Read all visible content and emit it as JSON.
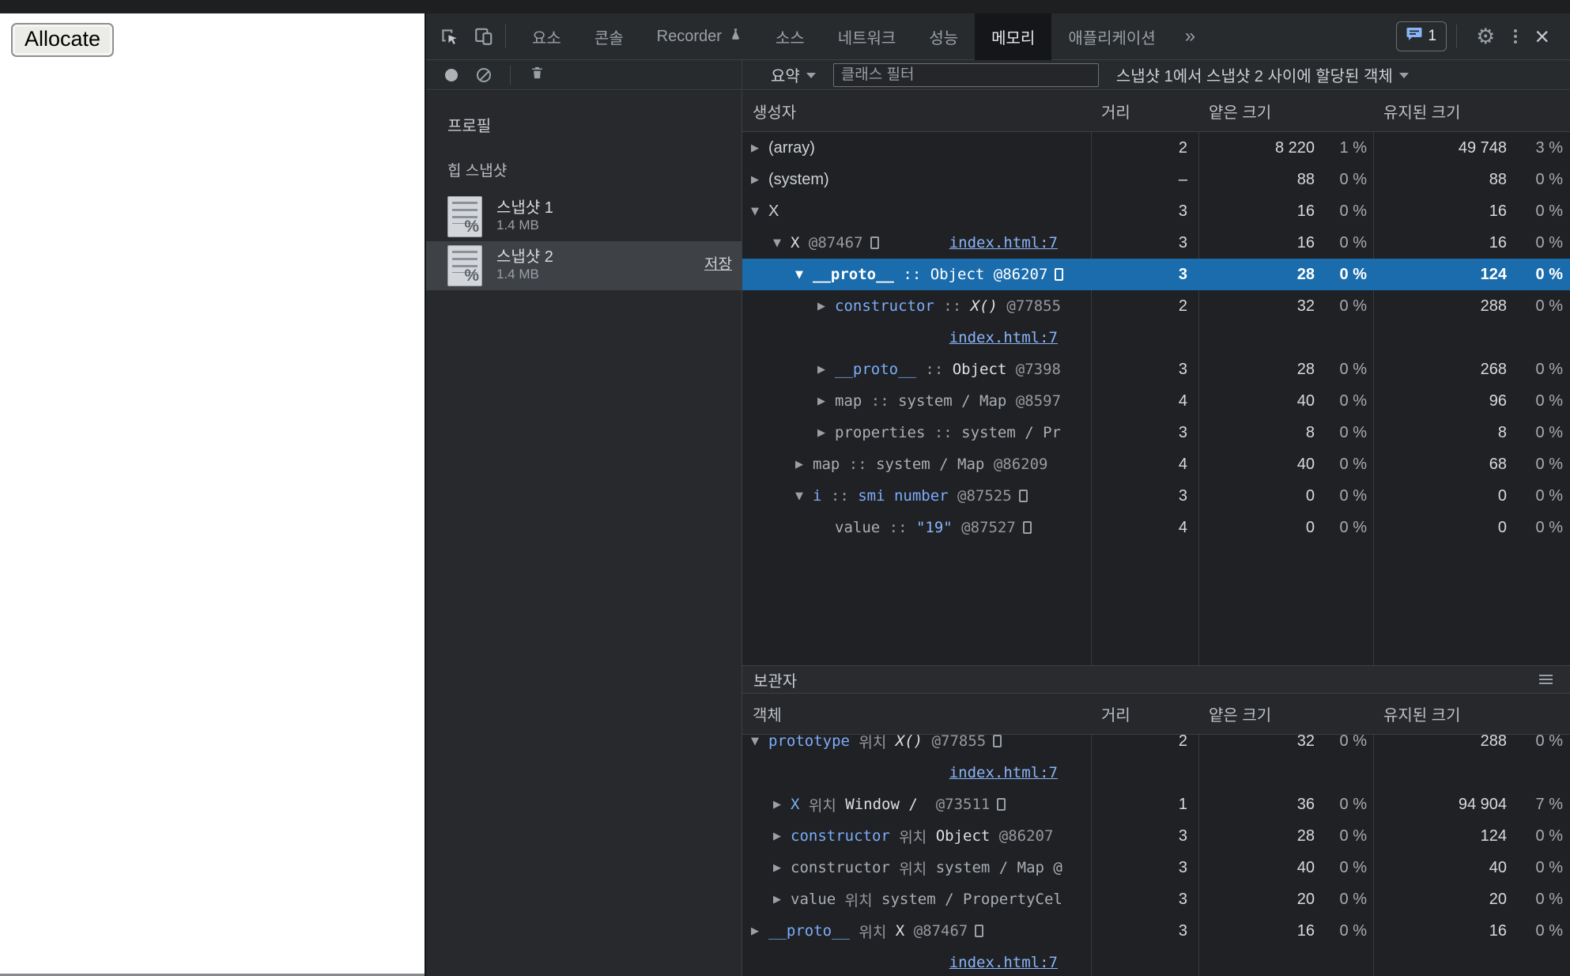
{
  "page": {
    "allocate_button": "Allocate"
  },
  "devtools": {
    "colors": {
      "selection_blue": "#1a6cac",
      "link_blue": "#8ab4f8",
      "property_blue": "#7cacf8",
      "panel_bg": "#1f2124",
      "chrome_bg": "#282b2e"
    },
    "tabs": {
      "items": [
        "요소",
        "콘솔",
        "Recorder",
        "소스",
        "네트워크",
        "성능",
        "메모리",
        "애플리케이션"
      ],
      "selected": "메모리",
      "overflow": "»",
      "issues_badge": "1"
    },
    "toolbar": {
      "summary_label": "요약",
      "filter_placeholder": "클래스 필터",
      "scope_label": "스냅샷 1에서 스냅샷 2 사이에 할당된 객체"
    },
    "sidebar": {
      "profiles_label": "프로필",
      "heap_label": "힙 스냅샷",
      "snapshots": [
        {
          "title": "스냅샷 1",
          "size": "1.4 MB"
        },
        {
          "title": "스냅샷 2",
          "size": "1.4 MB",
          "save": "저장"
        }
      ]
    },
    "grid": {
      "headers": {
        "constructor": "생성자",
        "distance": "거리",
        "shallow": "얕은 크기",
        "retained": "유지된 크기"
      },
      "rows": [
        {
          "arrow": "▶",
          "segs": [
            {
              "t": "(array)",
              "c": "cname"
            }
          ],
          "d": "2",
          "sn": "8 220",
          "sp": "1 %",
          "rn": "49 748",
          "rp": "3 %"
        },
        {
          "arrow": "▶",
          "segs": [
            {
              "t": "(system)",
              "c": "cname"
            }
          ],
          "d": "–",
          "sn": "88",
          "sp": "0 %",
          "rn": "88",
          "rp": "0 %"
        },
        {
          "arrow": "▼",
          "segs": [
            {
              "t": "X",
              "c": "cname"
            }
          ],
          "d": "3",
          "sn": "16",
          "sp": "0 %",
          "rn": "16",
          "rp": "0 %"
        },
        {
          "arrow": "▼",
          "segs": [
            {
              "t": "X",
              "c": "val"
            },
            {
              "t": " @87467",
              "c": "dim"
            },
            {
              "c": "icon"
            }
          ],
          "link": "index.html:7",
          "d": "3",
          "sn": "16",
          "sp": "0 %",
          "rn": "16",
          "rp": "0 %"
        },
        {
          "arrow": "▼",
          "segs": [
            {
              "t": "__proto__",
              "c": "selb"
            },
            {
              "t": " :: ",
              "c": "selt"
            },
            {
              "t": "Object @86207",
              "c": "selt"
            },
            {
              "c": "iconw"
            }
          ],
          "d": "3",
          "sn": "28",
          "sp": "0 %",
          "rn": "124",
          "rp": "0 %"
        },
        {
          "arrow": "▶",
          "segs": [
            {
              "t": "constructor",
              "c": "prop"
            },
            {
              "t": " :: ",
              "c": "dim"
            },
            {
              "t": "X()",
              "c": "fn"
            },
            {
              "t": " @77855",
              "c": "dim"
            }
          ],
          "link": "index.html:7",
          "d": "2",
          "sn": "32",
          "sp": "0 %",
          "rn": "288",
          "rp": "0 %"
        },
        {
          "arrow": "▶",
          "segs": [
            {
              "t": "__proto__",
              "c": "prop"
            },
            {
              "t": " :: ",
              "c": "dim"
            },
            {
              "t": "Object",
              "c": "val"
            },
            {
              "t": " @7398",
              "c": "dim"
            }
          ],
          "d": "3",
          "sn": "28",
          "sp": "0 %",
          "rn": "268",
          "rp": "0 %"
        },
        {
          "arrow": "▶",
          "segs": [
            {
              "t": "map",
              "c": "dim2"
            },
            {
              "t": " :: ",
              "c": "dim"
            },
            {
              "t": "system / Map",
              "c": "dim2"
            },
            {
              "t": " @8597",
              "c": "dim"
            }
          ],
          "d": "4",
          "sn": "40",
          "sp": "0 %",
          "rn": "96",
          "rp": "0 %"
        },
        {
          "arrow": "▶",
          "segs": [
            {
              "t": "properties",
              "c": "dim2"
            },
            {
              "t": " :: ",
              "c": "dim"
            },
            {
              "t": "system / Pr",
              "c": "dim2"
            }
          ],
          "d": "3",
          "sn": "8",
          "sp": "0 %",
          "rn": "8",
          "rp": "0 %"
        },
        {
          "arrow": "▶",
          "segs": [
            {
              "t": "map",
              "c": "dim2"
            },
            {
              "t": " :: ",
              "c": "dim"
            },
            {
              "t": "system / Map",
              "c": "dim2"
            },
            {
              "t": " @86209",
              "c": "dim"
            }
          ],
          "d": "4",
          "sn": "40",
          "sp": "0 %",
          "rn": "68",
          "rp": "0 %"
        },
        {
          "arrow": "▼",
          "segs": [
            {
              "t": "i",
              "c": "prop"
            },
            {
              "t": " :: ",
              "c": "dim"
            },
            {
              "t": "smi number",
              "c": "prop"
            },
            {
              "t": " @87525",
              "c": "dim"
            },
            {
              "c": "icon"
            }
          ],
          "d": "3",
          "sn": "0",
          "sp": "0 %",
          "rn": "0",
          "rp": "0 %"
        },
        {
          "arrow": "",
          "segs": [
            {
              "t": "value",
              "c": "dim2"
            },
            {
              "t": " :: ",
              "c": "dim"
            },
            {
              "t": "\"19\"",
              "c": "str"
            },
            {
              "t": " @87527",
              "c": "dim"
            },
            {
              "c": "icon"
            }
          ],
          "d": "4",
          "sn": "0",
          "sp": "0 %",
          "rn": "0",
          "rp": "0 %"
        }
      ]
    },
    "retainers": {
      "title": "보관자",
      "headers": {
        "object": "객체",
        "distance": "거리",
        "shallow": "얕은 크기",
        "retained": "유지된 크기"
      },
      "rows": [
        {
          "arrow": "▼",
          "segs": [
            {
              "t": "prototype",
              "c": "prop"
            },
            {
              "t": " 위치 ",
              "c": "dim"
            },
            {
              "t": "X()",
              "c": "fn"
            },
            {
              "t": " @77855",
              "c": "dim"
            },
            {
              "c": "icon"
            }
          ],
          "link": "index.html:7",
          "d": "2",
          "sn": "32",
          "sp": "0 %",
          "rn": "288",
          "rp": "0 %"
        },
        {
          "arrow": "▶",
          "segs": [
            {
              "t": "X",
              "c": "prop"
            },
            {
              "t": " 위치 ",
              "c": "dim"
            },
            {
              "t": "Window /",
              "c": "val"
            },
            {
              "t": "  @73511",
              "c": "dim"
            },
            {
              "c": "icon"
            }
          ],
          "d": "1",
          "sn": "36",
          "sp": "0 %",
          "rn": "94 904",
          "rp": "7 %"
        },
        {
          "arrow": "▶",
          "segs": [
            {
              "t": "constructor",
              "c": "prop"
            },
            {
              "t": " 위치 ",
              "c": "dim"
            },
            {
              "t": "Object",
              "c": "val"
            },
            {
              "t": " @86207",
              "c": "dim"
            }
          ],
          "d": "3",
          "sn": "28",
          "sp": "0 %",
          "rn": "124",
          "rp": "0 %"
        },
        {
          "arrow": "▶",
          "segs": [
            {
              "t": "constructor",
              "c": "dim2"
            },
            {
              "t": " 위치 ",
              "c": "dim"
            },
            {
              "t": "system / Map @",
              "c": "dim2"
            }
          ],
          "d": "3",
          "sn": "40",
          "sp": "0 %",
          "rn": "40",
          "rp": "0 %"
        },
        {
          "arrow": "▶",
          "segs": [
            {
              "t": "value",
              "c": "dim2"
            },
            {
              "t": " 위치 ",
              "c": "dim"
            },
            {
              "t": "system / PropertyCel",
              "c": "dim2"
            }
          ],
          "d": "3",
          "sn": "20",
          "sp": "0 %",
          "rn": "20",
          "rp": "0 %"
        },
        {
          "arrow": "▶",
          "segs": [
            {
              "t": "__proto__",
              "c": "prop"
            },
            {
              "t": " 위치 ",
              "c": "dim"
            },
            {
              "t": "X",
              "c": "val"
            },
            {
              "t": " @87467",
              "c": "dim"
            },
            {
              "c": "icon"
            }
          ],
          "link": "index.html:7",
          "d": "3",
          "sn": "16",
          "sp": "0 %",
          "rn": "16",
          "rp": "0 %"
        }
      ]
    }
  }
}
